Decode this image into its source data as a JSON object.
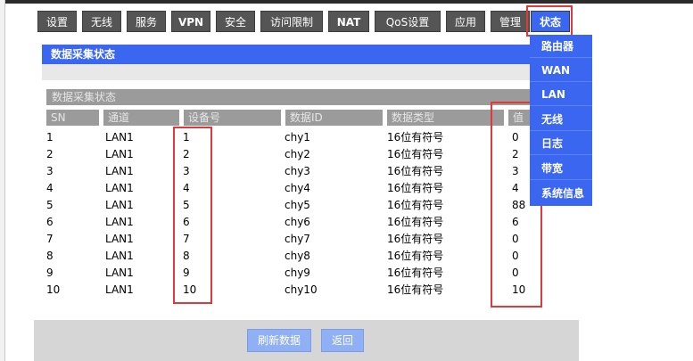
{
  "nav": {
    "tabs": [
      {
        "label": "设置"
      },
      {
        "label": "无线"
      },
      {
        "label": "服务"
      },
      {
        "label": "VPN"
      },
      {
        "label": "安全"
      },
      {
        "label": "访问限制"
      },
      {
        "label": "NAT"
      },
      {
        "label": "QoS设置"
      },
      {
        "label": "应用"
      },
      {
        "label": "管理"
      },
      {
        "label": "状态"
      }
    ],
    "active_tab": "状态"
  },
  "status_menu": {
    "items": [
      {
        "label": "路由器"
      },
      {
        "label": "WAN"
      },
      {
        "label": "LAN"
      },
      {
        "label": "无线"
      },
      {
        "label": "日志"
      },
      {
        "label": "带宽"
      },
      {
        "label": "系统信息"
      }
    ]
  },
  "section": {
    "title": "数据采集状态"
  },
  "table": {
    "caption": "数据采集状态",
    "headers": {
      "sn": "SN",
      "channel": "通道",
      "device": "设备号",
      "data_id": "数据ID",
      "data_type": "数据类型",
      "value": "值"
    },
    "rows": [
      {
        "sn": "1",
        "channel": "LAN1",
        "device": "1",
        "data_id": "chy1",
        "data_type": "16位有符号",
        "value": "0"
      },
      {
        "sn": "2",
        "channel": "LAN1",
        "device": "2",
        "data_id": "chy2",
        "data_type": "16位有符号",
        "value": "2"
      },
      {
        "sn": "3",
        "channel": "LAN1",
        "device": "3",
        "data_id": "chy3",
        "data_type": "16位有符号",
        "value": "3"
      },
      {
        "sn": "4",
        "channel": "LAN1",
        "device": "4",
        "data_id": "chy4",
        "data_type": "16位有符号",
        "value": "4"
      },
      {
        "sn": "5",
        "channel": "LAN1",
        "device": "5",
        "data_id": "chy5",
        "data_type": "16位有符号",
        "value": "88"
      },
      {
        "sn": "6",
        "channel": "LAN1",
        "device": "6",
        "data_id": "chy6",
        "data_type": "16位有符号",
        "value": "6"
      },
      {
        "sn": "7",
        "channel": "LAN1",
        "device": "7",
        "data_id": "chy7",
        "data_type": "16位有符号",
        "value": "0"
      },
      {
        "sn": "8",
        "channel": "LAN1",
        "device": "8",
        "data_id": "chy8",
        "data_type": "16位有符号",
        "value": "0"
      },
      {
        "sn": "9",
        "channel": "LAN1",
        "device": "9",
        "data_id": "chy9",
        "data_type": "16位有符号",
        "value": "0"
      },
      {
        "sn": "10",
        "channel": "LAN1",
        "device": "10",
        "data_id": "chy10",
        "data_type": "16位有符号",
        "value": "10"
      }
    ]
  },
  "actions": {
    "refresh_label": "刷新数据",
    "back_label": "返回"
  },
  "colors": {
    "accent_blue": "#3a66f0",
    "tab_gray": "#555555",
    "header_gray": "#9b9b9b",
    "highlight_red": "#e0393b",
    "button_blue": "#8fb0f5"
  }
}
